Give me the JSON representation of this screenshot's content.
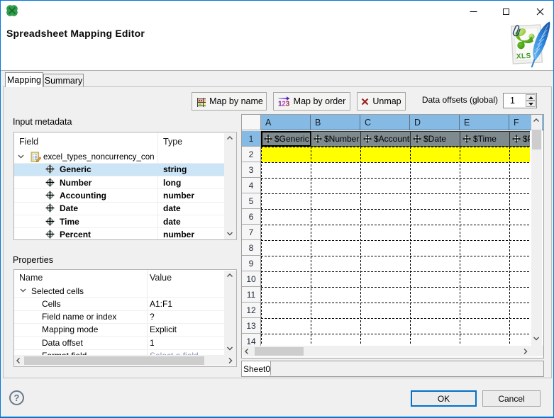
{
  "window": {
    "accent_color": "#0078d7",
    "icon": "clover-icon",
    "controls": {
      "minimize": "minimize-icon",
      "maximize": "maximize-icon",
      "close": "close-icon"
    }
  },
  "header": {
    "title": "Spreadsheet Mapping Editor",
    "logo": "xls-file-with-feather-icon"
  },
  "tabs": [
    {
      "label": "Mapping",
      "selected": true
    },
    {
      "label": "Summary",
      "selected": false
    }
  ],
  "toolbar": {
    "buttons": [
      {
        "label": "Map by name",
        "icon": "table-map-icon"
      },
      {
        "label": "Map by order",
        "icon": "arrow-123-icon"
      },
      {
        "label": "Unmap",
        "icon": "red-x-icon"
      }
    ],
    "offsets_label": "Data offsets (global)",
    "offsets_value": "1"
  },
  "input_metadata": {
    "label": "Input metadata",
    "columns": [
      "Field",
      "Type"
    ],
    "root": {
      "name": "excel_types_noncurrency_con",
      "icon": "record-icon",
      "expanded": true
    },
    "fields": [
      {
        "name": "Generic",
        "type": "string",
        "selected": true
      },
      {
        "name": "Number",
        "type": "long",
        "selected": false
      },
      {
        "name": "Accounting",
        "type": "number",
        "selected": false
      },
      {
        "name": "Date",
        "type": "date",
        "selected": false
      },
      {
        "name": "Time",
        "type": "date",
        "selected": false
      },
      {
        "name": "Percent",
        "type": "number",
        "selected": false
      }
    ],
    "field_icon": "crosshair-icon"
  },
  "properties": {
    "label": "Properties",
    "columns": [
      "Name",
      "Value"
    ],
    "rows": [
      {
        "name": "Selected cells",
        "value": "",
        "group": true,
        "partial": false
      },
      {
        "name": "Cells",
        "value": "A1:F1",
        "group": false,
        "partial": false
      },
      {
        "name": "Field name or index",
        "value": "?",
        "group": false,
        "partial": false
      },
      {
        "name": "Mapping mode",
        "value": "Explicit",
        "group": false,
        "partial": false
      },
      {
        "name": "Data offset",
        "value": "1",
        "group": false,
        "partial": false
      },
      {
        "name": "Format field",
        "value": "Select a field",
        "group": false,
        "partial": true
      }
    ]
  },
  "grid": {
    "columns": [
      "A",
      "B",
      "C",
      "D",
      "E",
      "F"
    ],
    "row_numbers": [
      "1",
      "2",
      "3",
      "4",
      "5",
      "6",
      "7",
      "8",
      "9",
      "10",
      "11",
      "12",
      "13",
      "14"
    ],
    "mapped_cells": [
      "$Generic",
      "$Number",
      "$Accounting",
      "$Date",
      "$Time",
      "$Percent"
    ],
    "mapped_cell_icon": "crosshair-icon",
    "selected_row": "1",
    "highlight_row": "2",
    "sheet_tab": "Sheet0"
  },
  "footer": {
    "help_label": "?",
    "ok_label": "OK",
    "cancel_label": "Cancel"
  }
}
